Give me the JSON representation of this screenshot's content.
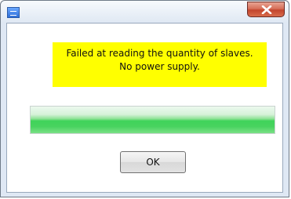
{
  "window": {
    "icon": "app-icon"
  },
  "titlebar": {
    "close_icon": "close-icon"
  },
  "message": {
    "line1": "Failed at reading the quantity of slaves.",
    "line2": "No power supply.",
    "background": "#ffff00"
  },
  "progress": {
    "fraction": 1.0,
    "color": "#3fd35a"
  },
  "buttons": {
    "ok_label": "OK"
  }
}
